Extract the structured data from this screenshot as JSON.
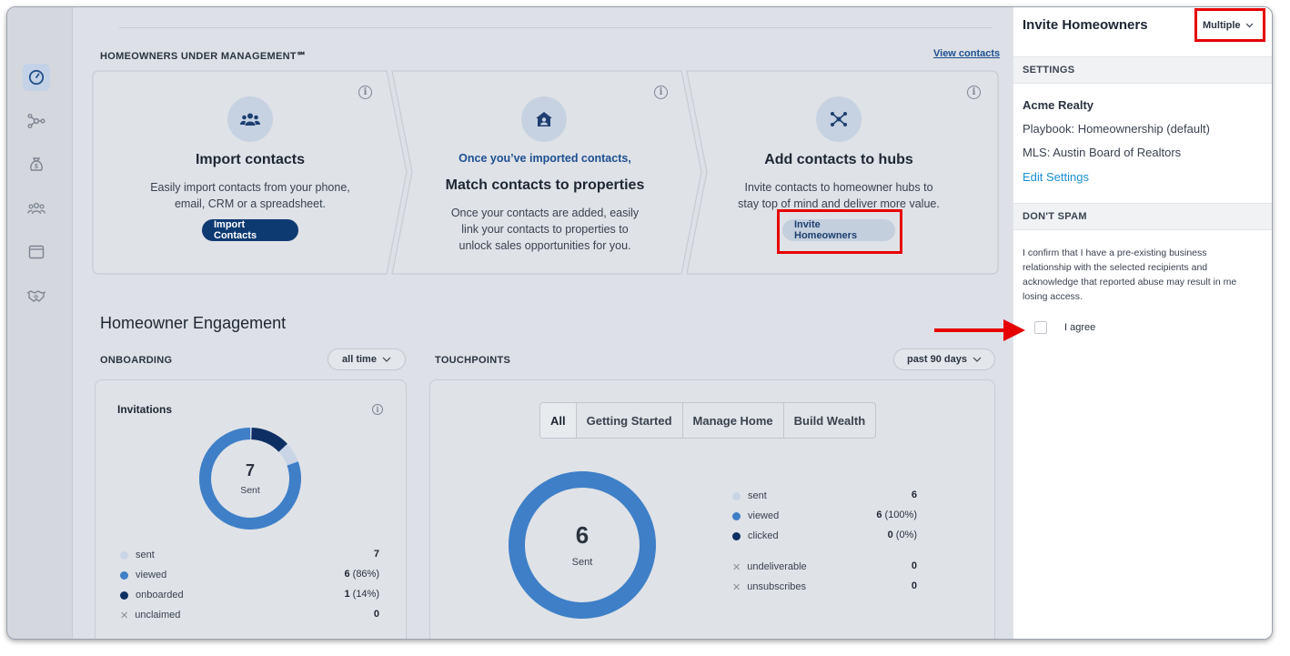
{
  "nav": {
    "items": [
      {
        "name": "dashboard-icon",
        "active": true
      },
      {
        "name": "network-icon",
        "active": false
      },
      {
        "name": "money-bag-icon",
        "active": false
      },
      {
        "name": "people-icon",
        "active": false
      },
      {
        "name": "browser-window-icon",
        "active": false
      },
      {
        "name": "handshake-icon",
        "active": false
      }
    ]
  },
  "hum": {
    "title": "HOMEOWNERS UNDER MANAGEMENT℠",
    "view_link": "View contacts",
    "steps": [
      {
        "icon": "people-icon",
        "title": "Import contacts",
        "desc_1": "Easily import contacts from your phone,",
        "desc_2": "email, CRM or a spreadsheet.",
        "button": "Import Contacts"
      },
      {
        "icon": "home-user-icon",
        "subtitle": "Once you’ve imported contacts,",
        "title": "Match contacts to properties",
        "desc_1": "Once your contacts are added, easily",
        "desc_2": "link your contacts to properties to",
        "desc_3": "unlock sales opportunities for you."
      },
      {
        "icon": "hub-icon",
        "title": "Add contacts to hubs",
        "desc_1": "Invite contacts to homeowner hubs to",
        "desc_2": "stay top of mind and deliver more value.",
        "button": "Invite Homeowners"
      }
    ]
  },
  "engagement": {
    "title": "Homeowner Engagement",
    "onboarding": {
      "label": "ONBOARDING",
      "filter": "all time",
      "card_title": "Invitations",
      "donut_value": "7",
      "donut_label": "Sent",
      "viewed_fraction": 0.86,
      "onboarded_fraction": 0.14,
      "legend": [
        {
          "label": "sent",
          "value": "7",
          "pct": "",
          "color": "#c9d5e6",
          "marker": "dot"
        },
        {
          "label": "viewed",
          "value": "6",
          "pct": " (86%)",
          "color": "#3e7fc7",
          "marker": "dot"
        },
        {
          "label": "onboarded",
          "value": "1",
          "pct": " (14%)",
          "color": "#0e2f63",
          "marker": "dot"
        },
        {
          "label": "unclaimed",
          "value": "0",
          "pct": "",
          "color": "#8a909a",
          "marker": "x"
        }
      ]
    },
    "touchpoints": {
      "label": "TOUCHPOINTS",
      "filter": "past 90 days",
      "tabs": [
        "All",
        "Getting Started",
        "Manage Home",
        "Build Wealth"
      ],
      "active_tab": 0,
      "donut_value": "6",
      "donut_label": "Sent",
      "viewed_fraction": 1.0,
      "legend": [
        {
          "label": "sent",
          "value": "6",
          "pct": "",
          "color": "#c9d5e6",
          "marker": "dot"
        },
        {
          "label": "viewed",
          "value": "6",
          "pct": " (100%)",
          "color": "#3e7fc7",
          "marker": "dot"
        },
        {
          "label": "clicked",
          "value": "0",
          "pct": " (0%)",
          "color": "#0e2f63",
          "marker": "dot"
        },
        {
          "label": "undeliverable",
          "value": "0",
          "pct": "",
          "color": "#8a909a",
          "marker": "x"
        },
        {
          "label": "unsubscribes",
          "value": "0",
          "pct": "",
          "color": "#8a909a",
          "marker": "x"
        }
      ]
    }
  },
  "panel": {
    "title": "Invite Homeowners",
    "mode": "Multiple",
    "settings_header": "SETTINGS",
    "agency": "Acme Realty",
    "playbook": "Playbook: Homeownership (default)",
    "mls": "MLS: Austin Board of Realtors",
    "edit_link": "Edit Settings",
    "spam_header": "DON'T SPAM",
    "spam_text_1": "I confirm that I have a pre-existing business",
    "spam_text_2": "relationship with the selected recipients and",
    "spam_text_3": "acknowledge that reported abuse may result in me",
    "spam_text_4": "losing access.",
    "agree_label": "I agree",
    "agree_checked": false
  },
  "colors": {
    "brand_dark": "#0e3a72",
    "viewed": "#3e7fc7",
    "sent": "#c9d5e6",
    "onboarded": "#0e2f63",
    "highlight": "#e60000",
    "link": "#1a8fd6"
  }
}
